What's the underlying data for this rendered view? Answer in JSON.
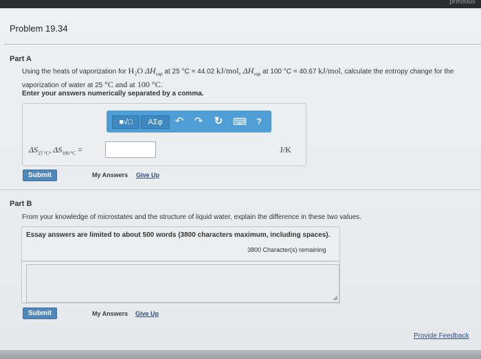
{
  "topbar": {
    "previous_label": "previous"
  },
  "problem": {
    "title": "Problem 19.34"
  },
  "part_a": {
    "label": "Part A",
    "question_line1_prefix": "Using the heats of vaporization for ",
    "question_compound": "H₂O",
    "question_dh1": "ΔH",
    "question_sub_vap": "vap",
    "question_at1": " at 25 °C = 44.02 ",
    "question_unit1": "kJ/mol",
    "question_comma": ", ",
    "question_dh2": "ΔH",
    "question_at2": " at 100 °C = 40.67 ",
    "question_unit2": "kJ/mol",
    "question_line1_suffix": ", calculate the entropy change for the",
    "question_line2_prefix": "vaporization of water at 25 ",
    "question_line2_mid": "C and at 100 ",
    "question_line2_end": "C.",
    "degree": "°",
    "instruction": "Enter your answers numerically separated by a comma.",
    "toolbar": {
      "templates_icon": "■√□",
      "symbols_label": "ΑΣφ",
      "undo_icon": "↶",
      "redo_icon": "↷",
      "reset_icon": "↻",
      "keyboard_icon": "⌨",
      "help_icon": "?"
    },
    "formula": {
      "ds": "ΔS",
      "sub1": "25 °C",
      "comma": ", ",
      "sub2": "100 °C",
      "equals": " ="
    },
    "answer_value": "",
    "unit": "J/K",
    "submit_label": "Submit",
    "my_answers_label": "My Answers",
    "give_up_label": "Give Up"
  },
  "part_b": {
    "label": "Part B",
    "question": "From your knowledge of microstates and the structure of liquid water, explain the difference in these two values.",
    "essay_note": "Essay answers are limited to about 500 words (3800 characters maximum, including spaces).",
    "chars_remaining": "3800 Character(s) remaining",
    "essay_value": "",
    "resize_grip": "◢",
    "submit_label": "Submit",
    "my_answers_label": "My Answers",
    "give_up_label": "Give Up"
  },
  "footer": {
    "feedback_label": "Provide Feedback"
  },
  "colors": {
    "toolbar_blue": "#4f9fd6",
    "submit_blue": "#4f88b8",
    "link_blue": "#2d4f7c"
  }
}
